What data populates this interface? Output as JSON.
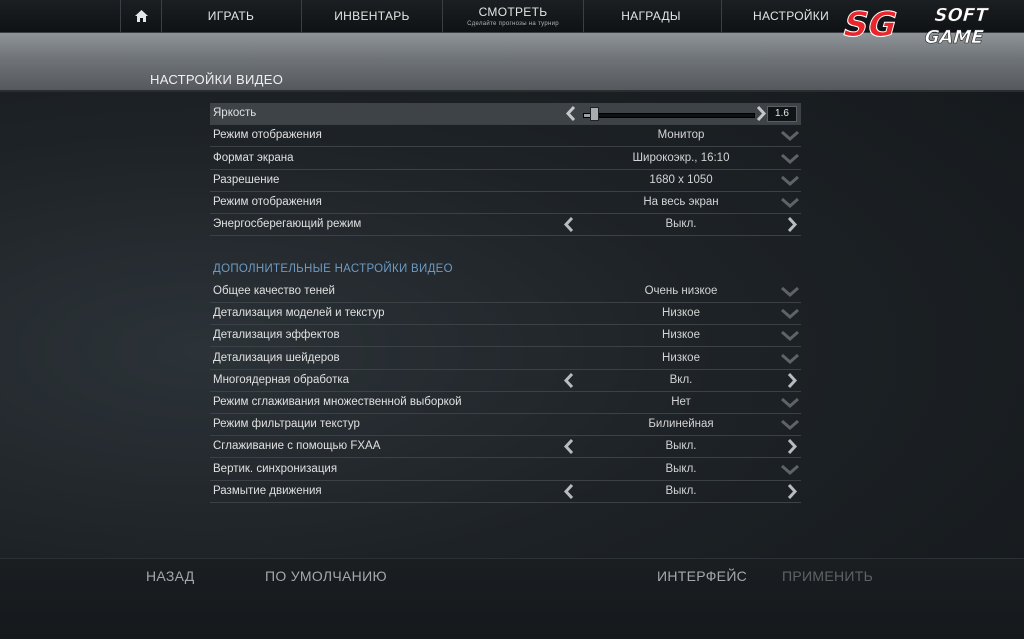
{
  "nav": {
    "items": [
      {
        "label": "ИГРАТЬ"
      },
      {
        "label": "ИНВЕНТАРЬ"
      },
      {
        "label": "СМОТРЕТЬ",
        "sub": "Сделайте прогнозы на турнир"
      },
      {
        "label": "НАГРАДЫ"
      },
      {
        "label": "НАСТРОЙКИ"
      }
    ]
  },
  "logo": {
    "top": "SOFT",
    "bottom": "GAME",
    "mark": "SG"
  },
  "page": {
    "title": "НАСТРОЙКИ ВИДЕО"
  },
  "brightness": {
    "label": "Яркость",
    "value": "1.6",
    "level": 0.06
  },
  "video_rows": [
    {
      "label": "Режим отображения",
      "value": "Монитор",
      "control": "dropdown"
    },
    {
      "label": "Формат экрана",
      "value": "Широкоэкр., 16:10",
      "control": "dropdown"
    },
    {
      "label": "Разрешение",
      "value": "1680 x 1050",
      "control": "dropdown"
    },
    {
      "label": "Режим отображения",
      "value": "На весь экран",
      "control": "dropdown"
    },
    {
      "label": "Энергосберегающий режим",
      "value": "Выкл.",
      "control": "arrows"
    }
  ],
  "advanced": {
    "title": "ДОПОЛНИТЕЛЬНЫЕ НАСТРОЙКИ ВИДЕО",
    "rows": [
      {
        "label": "Общее качество теней",
        "value": "Очень низкое",
        "control": "dropdown"
      },
      {
        "label": "Детализация моделей и текстур",
        "value": "Низкое",
        "control": "dropdown"
      },
      {
        "label": "Детализация эффектов",
        "value": "Низкое",
        "control": "dropdown"
      },
      {
        "label": "Детализация шейдеров",
        "value": "Низкое",
        "control": "dropdown"
      },
      {
        "label": "Многоядерная обработка",
        "value": "Вкл.",
        "control": "arrows"
      },
      {
        "label": "Режим сглаживания множественной выборкой",
        "value": "Нет",
        "control": "dropdown"
      },
      {
        "label": "Режим фильтрации текстур",
        "value": "Билинейная",
        "control": "dropdown"
      },
      {
        "label": "Сглаживание с помощью FXAA",
        "value": "Выкл.",
        "control": "arrows"
      },
      {
        "label": "Вертик. синхронизация",
        "value": "Выкл.",
        "control": "dropdown"
      },
      {
        "label": "Размытие движения",
        "value": "Выкл.",
        "control": "arrows"
      }
    ]
  },
  "footer": {
    "back": "НАЗАД",
    "defaults": "ПО УМОЛЧАНИЮ",
    "interface": "ИНТЕРФЕЙС",
    "apply": "ПРИМЕНИТЬ"
  },
  "colors": {
    "accent": "#6d9ac2",
    "logo_red": "#e8262b"
  },
  "icons": [
    "home-icon",
    "chevron-left-icon",
    "chevron-right-icon",
    "chevron-down-icon"
  ]
}
